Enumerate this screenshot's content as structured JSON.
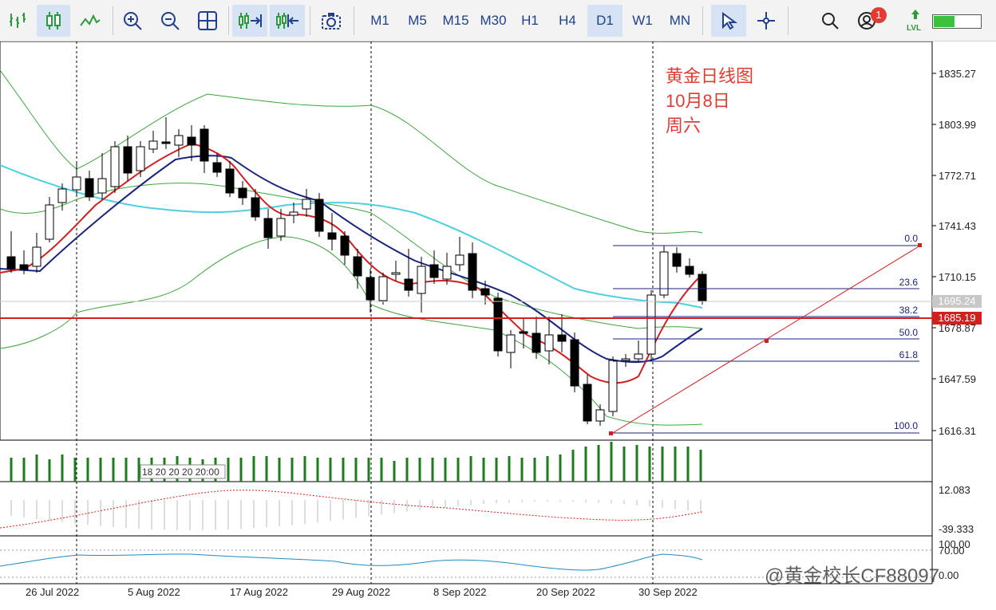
{
  "toolbar": {
    "tools": [
      "line-chart-icon",
      "candlestick-icon",
      "line-icon",
      "zoom-in-icon",
      "zoom-out-icon",
      "grid-icon",
      "auto-scroll-icon",
      "chart-shift-icon",
      "screenshot-icon"
    ],
    "timeframes": [
      "M1",
      "M5",
      "M15",
      "M30",
      "H1",
      "H4",
      "D1",
      "W1",
      "MN"
    ],
    "active_timeframe": "D1",
    "notification_count": "1",
    "lvl_label": "LVL",
    "battery_fraction": 0.45
  },
  "price_axis": {
    "ticks": [
      "1835.27",
      "1803.99",
      "1772.71",
      "1741.43",
      "1710.15",
      "1678.87",
      "1647.59",
      "1616.31"
    ],
    "current_price": "1695.24",
    "red_line_price": "1685.19",
    "macd_ticks": [
      "12.083",
      "-39.333"
    ],
    "rsi_ticks": [
      "100.00",
      "70.00",
      "0.00"
    ]
  },
  "time_axis": {
    "labels": [
      "26 Jul 2022",
      "5 Aug 2022",
      "17 Aug 2022",
      "29 Aug 2022",
      "8 Sep 2022",
      "20 Sep 2022",
      "30 Sep 2022"
    ]
  },
  "fibonacci": {
    "levels": [
      "0.0",
      "23.6",
      "38.2",
      "50.0",
      "61.8",
      "100.0"
    ]
  },
  "annotation": {
    "line1": "黄金日线图",
    "line2": "10月8日",
    "line3": "周六"
  },
  "volume_label": "18 20 20 20 20:00",
  "watermark": "@黄金校长CF88097",
  "colors": {
    "bull": "#ffffff",
    "bear": "#000000",
    "ma_fast": "#e03c31",
    "ma_slow": "#1a237e",
    "ma_long": "#4dd0e1",
    "bands": "#3aa83a",
    "volume": "#1e7d1e",
    "fib": "#1a237e",
    "red_line": "#d21f1f",
    "annotation": "#e03c31"
  }
}
